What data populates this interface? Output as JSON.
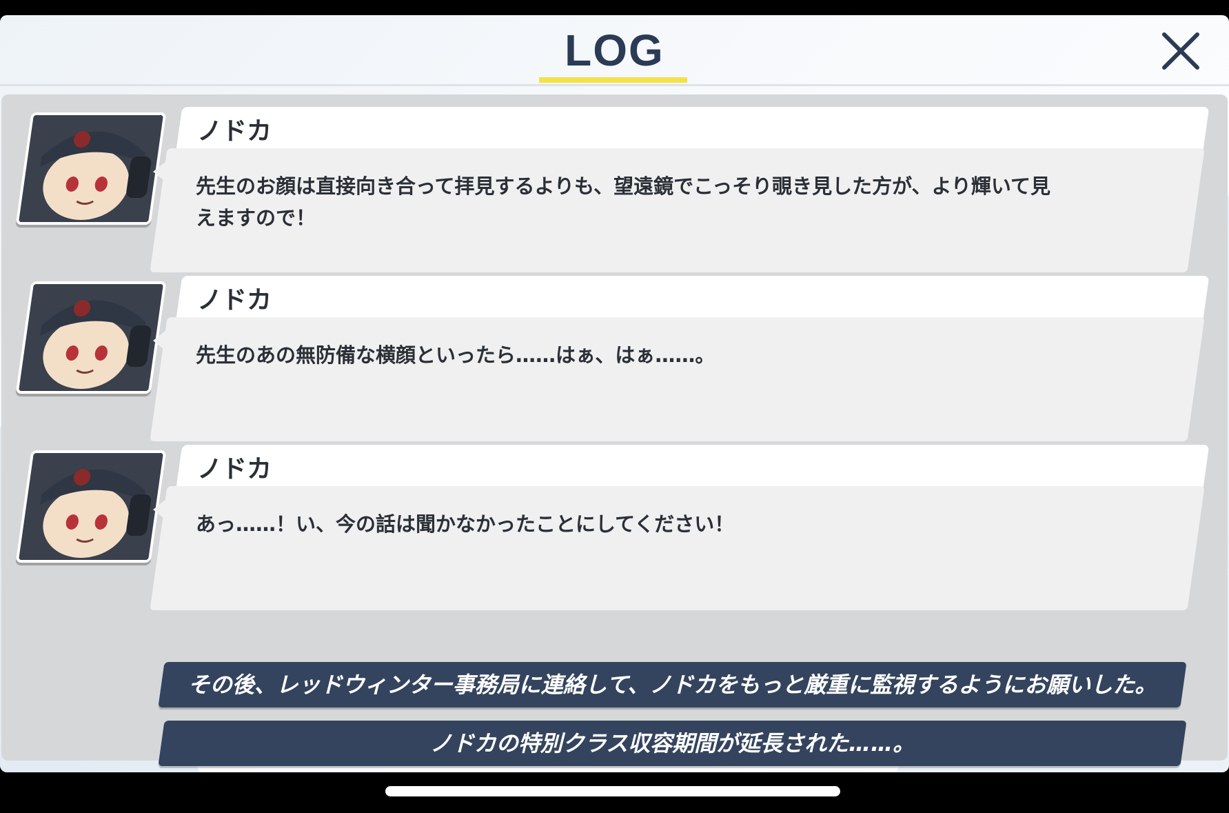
{
  "header": {
    "title": "LOG",
    "close_icon": "close-icon"
  },
  "entries": [
    {
      "speaker": "ノドカ",
      "text": "先生のお顔は直接向き合って拝見するよりも、望遠鏡でこっそり覗き見した方が、より輝いて見えますので！"
    },
    {
      "speaker": "ノドカ",
      "text": "先生のあの無防備な横顔といったら……はぁ、はぁ……。"
    },
    {
      "speaker": "ノドカ",
      "text": "あっ……！い、今の話は聞かなかったことにしてください！"
    }
  ],
  "narrations": [
    "その後、レッドウィンター事務局に連絡して、ノドカをもっと厳重に監視するようにお願いした。",
    "ノドカの特別クラス収容期間が延長された……。"
  ],
  "colors": {
    "accent_underline": "#f3e14a",
    "narration_bg": "#34445e",
    "title_text": "#2b3a55"
  }
}
